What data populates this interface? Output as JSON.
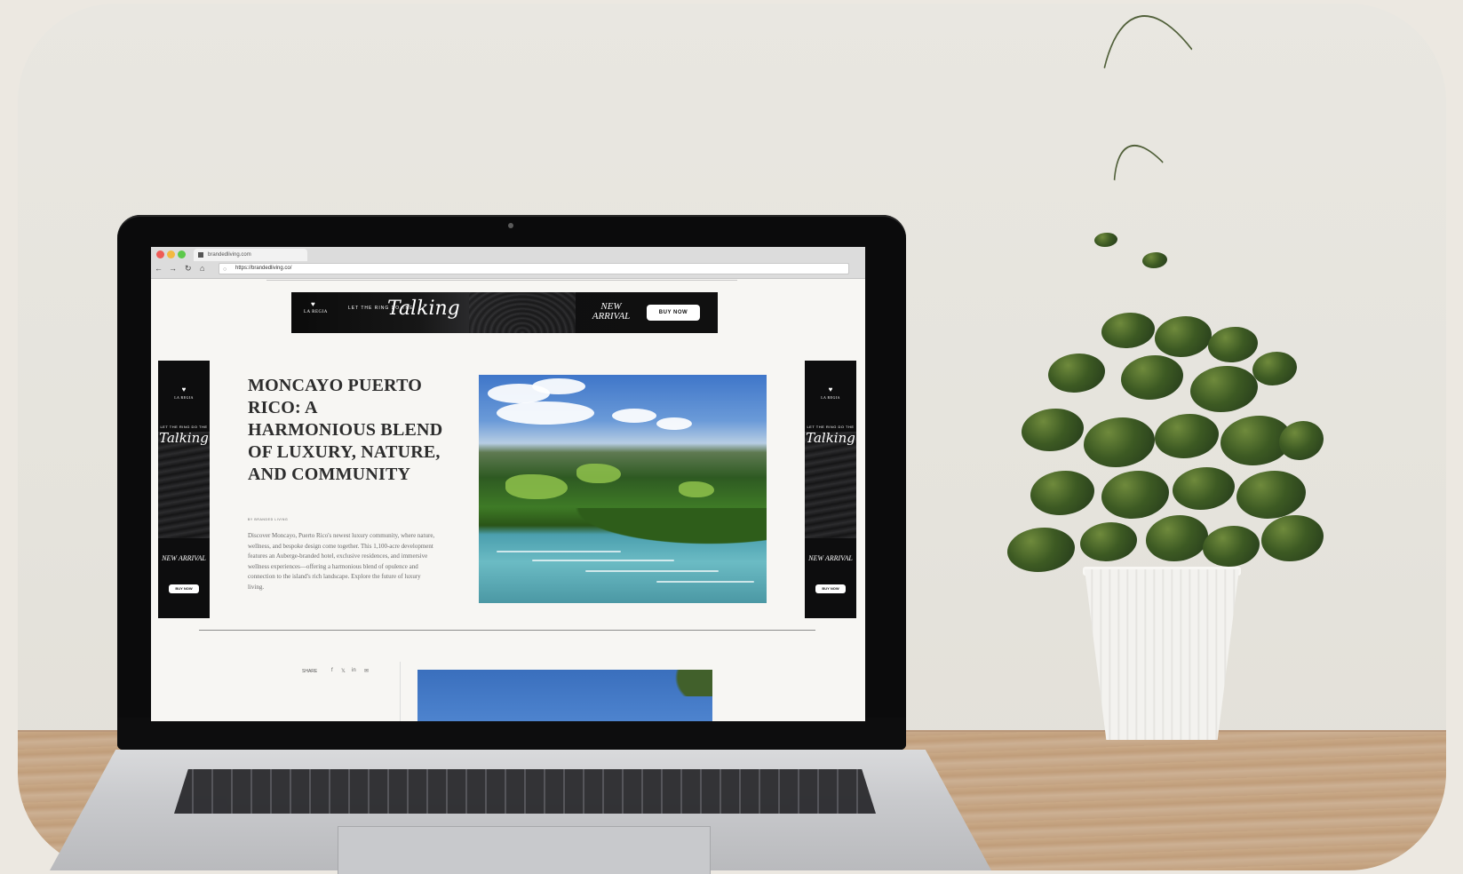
{
  "browser": {
    "tab_title": "brandedliving.com",
    "url": "https://brandedliving.co/",
    "nav": {
      "back_icon": "←",
      "forward_icon": "→",
      "reload_icon": "↻",
      "home_icon": "⌂"
    }
  },
  "leaderboard_ad": {
    "logo_text": "LA REGIA",
    "line1": "LET THE RING DO THE",
    "script_text": "Talking",
    "new_arrival": "NEW ARRIVAL",
    "cta": "BUY NOW"
  },
  "skyscraper_ad": {
    "logo_text": "LA REGIA",
    "line1": "LET THE RING DO THE",
    "script_text": "Talking",
    "new_arrival": "NEW ARRIVAL",
    "cta": "BUY NOW"
  },
  "article": {
    "headline": "MONCAYO PUERTO RICO: A HARMONIOUS BLEND OF LUXURY, NATURE, AND COMMUNITY",
    "byline": "BY BRANDED LIVING",
    "excerpt": "Discover Moncayo, Puerto Rico's newest luxury community, where nature, wellness, and bespoke design come together. This 1,100-acre development features an Auberge-branded hotel, exclusive residences, and immersive wellness experiences—offering a harmonious blend of opulence and connection to the island's rich landscape. Explore the future of luxury living."
  },
  "share": {
    "label": "SHARE",
    "icons": [
      "f",
      "𝕏",
      "in",
      "✉"
    ]
  },
  "colors": {
    "ad_black": "#0d0d0e",
    "page_bg": "#f7f6f3",
    "headline": "#2d2d2d"
  }
}
